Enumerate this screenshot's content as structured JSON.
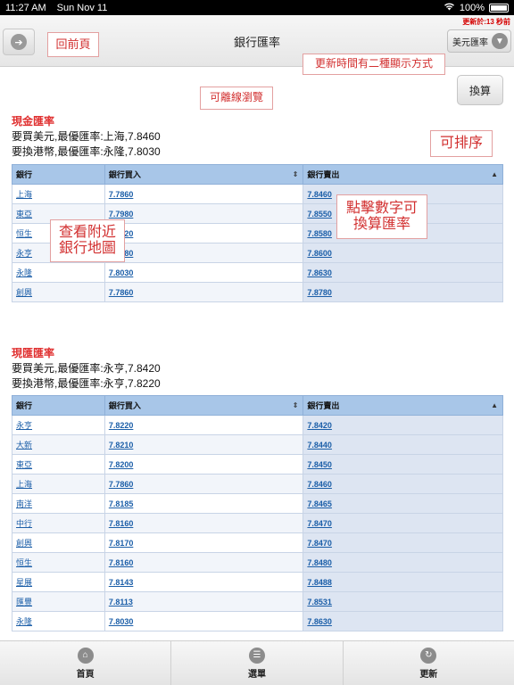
{
  "status_bar": {
    "time": "11:27 AM",
    "date": "Sun Nov 11",
    "battery": "100%"
  },
  "nav": {
    "title": "銀行匯率",
    "updated": "更新於:13 秒前",
    "currency_selector": "美元匯率"
  },
  "convert_button": "換算",
  "annotations": {
    "back": "回前頁",
    "update_time": "更新時間有二種顯示方式",
    "offline": "可離線瀏覽",
    "sortable": "可排序",
    "tap_number": "點擊數字可換算匯率",
    "map": "查看附近銀行地圖"
  },
  "cash": {
    "title": "現金匯率",
    "best_buy_usd": "要買美元,最優匯率:上海,7.8460",
    "best_sell_hkd": "要換港幣,最優匯率:永隆,7.8030",
    "headers": [
      "銀行",
      "銀行買入",
      "銀行賣出"
    ],
    "rows": [
      [
        "上海",
        "7.7860",
        "7.8460"
      ],
      [
        "東亞",
        "7.7980",
        "7.8550"
      ],
      [
        "恒生",
        "7.7920",
        "7.8580"
      ],
      [
        "永亨",
        "7.7980",
        "7.8600"
      ],
      [
        "永隆",
        "7.8030",
        "7.8630"
      ],
      [
        "創興",
        "7.7860",
        "7.8780"
      ]
    ]
  },
  "telegraphic": {
    "title": "現匯匯率",
    "best_buy_usd": "要買美元,最優匯率:永亨,7.8420",
    "best_sell_hkd": "要換港幣,最優匯率:永亨,7.8220",
    "headers": [
      "銀行",
      "銀行買入",
      "銀行賣出"
    ],
    "rows": [
      [
        "永亨",
        "7.8220",
        "7.8420"
      ],
      [
        "大新",
        "7.8210",
        "7.8440"
      ],
      [
        "東亞",
        "7.8200",
        "7.8450"
      ],
      [
        "上海",
        "7.7860",
        "7.8460"
      ],
      [
        "南洋",
        "7.8185",
        "7.8465"
      ],
      [
        "中行",
        "7.8160",
        "7.8470"
      ],
      [
        "創興",
        "7.8170",
        "7.8470"
      ],
      [
        "恒生",
        "7.8160",
        "7.8480"
      ],
      [
        "星展",
        "7.8143",
        "7.8488"
      ],
      [
        "匯豐",
        "7.8113",
        "7.8531"
      ],
      [
        "永隆",
        "7.8030",
        "7.8630"
      ]
    ]
  },
  "tabs": [
    {
      "label": "首頁",
      "icon": "home-icon"
    },
    {
      "label": "選單",
      "icon": "menu-icon"
    },
    {
      "label": "更新",
      "icon": "refresh-icon"
    }
  ]
}
